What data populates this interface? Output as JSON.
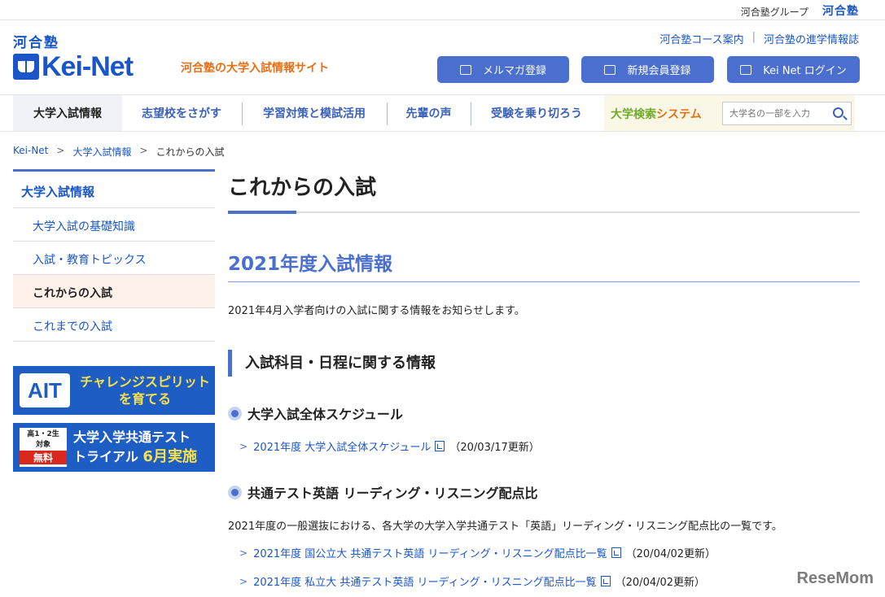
{
  "topbar": {
    "group_label": "河合塾グループ",
    "group_logo": "河合塾"
  },
  "header": {
    "logo_kanji": "河合塾",
    "logo_text": "Kei-Net",
    "tagline": "河合塾の大学入試情報サイト",
    "links": [
      "河合塾コース案内",
      "河合塾の進学情報誌"
    ],
    "buttons": [
      {
        "label": "メルマガ登録",
        "icon": "mail-icon"
      },
      {
        "label": "新規会員登録",
        "icon": "user-icon"
      },
      {
        "label": "Kei Net ログイン",
        "icon": "login-icon"
      }
    ]
  },
  "nav": {
    "items": [
      "大学入試情報",
      "志望校をさがす",
      "学習対策と模試活用",
      "先輩の声",
      "受験を乗り切ろう"
    ],
    "uni_search_label_a": "大学検索",
    "uni_search_label_b": "システム",
    "search_placeholder": "大学名の一部を入力"
  },
  "breadcrumb": [
    "Kei-Net",
    "大学入試情報",
    "これからの入試"
  ],
  "sidebar": {
    "heading": "大学入試情報",
    "items": [
      "大学入試の基礎知識",
      "入試・教育トピックス",
      "これからの入試",
      "これまでの入試"
    ],
    "active_index": 2
  },
  "banners": {
    "ait_logo": "AIT",
    "ait_line1": "チャレンジスピリット",
    "ait_line2": "を育てる",
    "trial_tag_top": "高1・2生",
    "trial_tag_mid": "対象",
    "trial_tag_red": "無料",
    "trial_line1": "大学入学共通テスト",
    "trial_line2": "トライアル",
    "trial_hl": "6月実施"
  },
  "main": {
    "page_title": "これからの入試",
    "h2": "2021年度入試情報",
    "intro": "2021年4月入学者向けの入試に関する情報をお知らせします。",
    "h3": "入試科目・日程に関する情報",
    "section1": {
      "title": "大学入試全体スケジュール",
      "links": [
        {
          "text": "2021年度 大学入試全体スケジュール",
          "updated": "（20/03/17更新）"
        }
      ]
    },
    "section2": {
      "title": "共通テスト英語 リーディング・リスニング配点比",
      "desc": "2021年度の一般選抜における、各大学の大学入学共通テスト「英語」リーディング・リスニング配点比の一覧です。",
      "links": [
        {
          "text": "2021年度 国公立大 共通テスト英語 リーディング・リスニング配点比一覧",
          "updated": "（20/04/02更新）"
        },
        {
          "text": "2021年度 私立大 共通テスト英語 リーディング・リスニング配点比一覧",
          "updated": "（20/04/02更新）"
        }
      ]
    }
  },
  "watermark": "ReseMom",
  "colors": {
    "brand_blue": "#1a56c8",
    "accent_blue": "#4a6fcf",
    "orange": "#e86f13",
    "green": "#6eab2a"
  }
}
